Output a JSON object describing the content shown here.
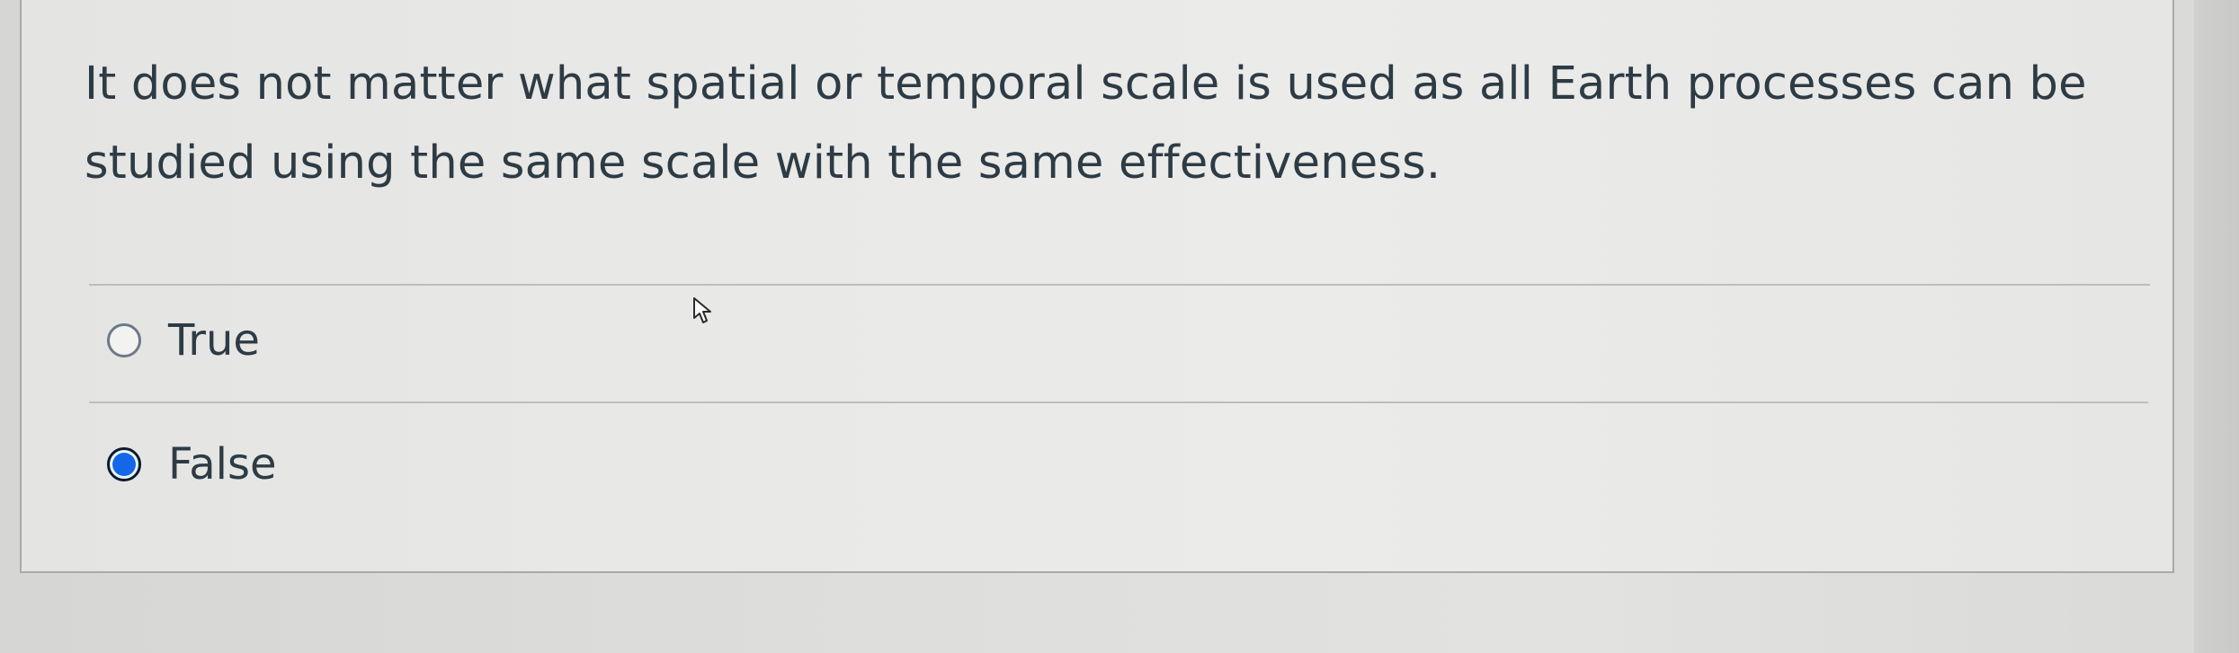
{
  "question": {
    "text": "It does not matter what spatial or temporal scale is used as all Earth processes can be studied using the same scale with the same effectiveness."
  },
  "options": [
    {
      "label": "True",
      "selected": false
    },
    {
      "label": "False",
      "selected": true
    }
  ],
  "colors": {
    "selected_radio": "#1467e8",
    "text": "#2d3b45"
  },
  "icons": {
    "cursor": "mouse-pointer-icon"
  }
}
